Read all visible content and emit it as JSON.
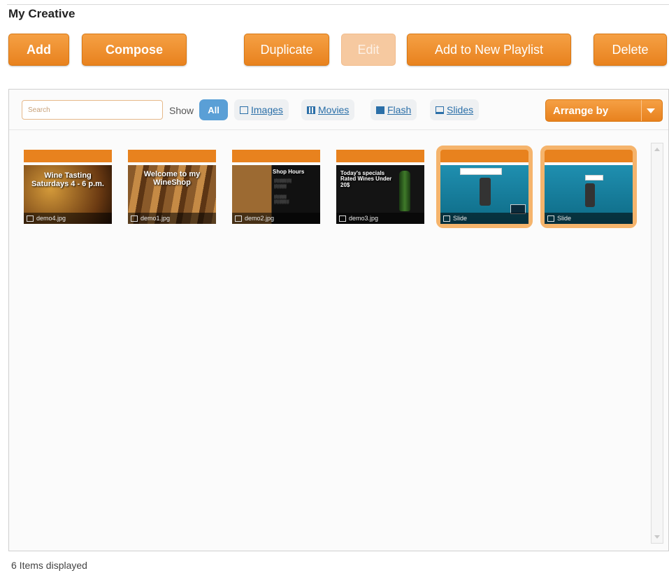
{
  "page": {
    "title": "My Creative"
  },
  "toolbar": {
    "add_label": "Add",
    "compose_label": "Compose",
    "duplicate_label": "Duplicate",
    "edit_label": "Edit",
    "add_to_playlist_label": "Add to New Playlist",
    "delete_label": "Delete"
  },
  "filter": {
    "search_placeholder": "Search",
    "show_label": "Show",
    "all_label": "All",
    "images_label": "Images",
    "movies_label": "Movies",
    "flash_label": "Flash",
    "slides_label": "Slides",
    "arrange_label": "Arrange by"
  },
  "items": [
    {
      "caption": "demo4.jpg",
      "text": "Wine Tasting Saturdays 4 - 6 p.m.",
      "selected": false
    },
    {
      "caption": "demo1.jpg",
      "text": "Welcome to my WineShop",
      "selected": false
    },
    {
      "caption": "demo2.jpg",
      "text": "Shop Hours",
      "selected": false
    },
    {
      "caption": "demo3.jpg",
      "text": "Today's specials Rated Wines Under 20$",
      "selected": false
    },
    {
      "caption": "Slide",
      "text": "",
      "selected": true
    },
    {
      "caption": "Slide",
      "text": "",
      "selected": true
    }
  ],
  "status": {
    "text": "6 Items displayed"
  },
  "colors": {
    "accent": "#e8821e",
    "selected_outline": "#f5b46c",
    "filter_active": "#5a9fd6"
  }
}
